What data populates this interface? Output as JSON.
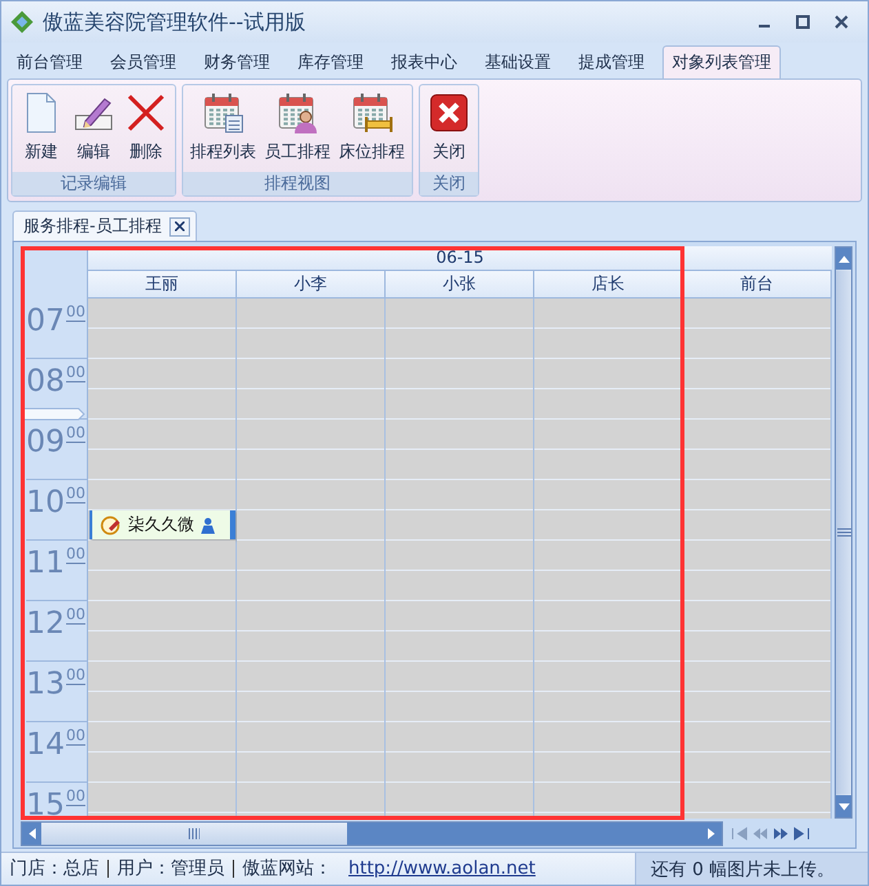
{
  "window": {
    "title": "傲蓝美容院管理软件--试用版"
  },
  "menu_tabs": [
    {
      "label": "前台管理",
      "selected": false
    },
    {
      "label": "会员管理",
      "selected": false
    },
    {
      "label": "财务管理",
      "selected": false
    },
    {
      "label": "库存管理",
      "selected": false
    },
    {
      "label": "报表中心",
      "selected": false
    },
    {
      "label": "基础设置",
      "selected": false
    },
    {
      "label": "提成管理",
      "selected": false
    },
    {
      "label": "对象列表管理",
      "selected": true
    }
  ],
  "ribbon_groups": [
    {
      "title": "记录编辑",
      "buttons": [
        {
          "label": "新建",
          "kind": "new"
        },
        {
          "label": "编辑",
          "kind": "edit"
        },
        {
          "label": "删除",
          "kind": "delete"
        }
      ]
    },
    {
      "title": "排程视图",
      "buttons": [
        {
          "label": "排程列表",
          "kind": "calendar-list"
        },
        {
          "label": "员工排程",
          "kind": "calendar-person"
        },
        {
          "label": "床位排程",
          "kind": "calendar-bed"
        }
      ]
    },
    {
      "title": "关闭",
      "buttons": [
        {
          "label": "关闭",
          "kind": "close"
        }
      ]
    }
  ],
  "document_tab": {
    "label": "服务排程-员工排程"
  },
  "schedule": {
    "date": "06-15",
    "resources": [
      {
        "name": "王丽"
      },
      {
        "name": "小李"
      },
      {
        "name": "小张"
      },
      {
        "name": "店长"
      },
      {
        "name": "前台"
      }
    ],
    "hours": [
      {
        "hour": "07",
        "minutes": "00"
      },
      {
        "hour": "08",
        "minutes": "00"
      },
      {
        "hour": "09",
        "minutes": "00"
      },
      {
        "hour": "10",
        "minutes": "00",
        "second_half": [
          "柒久久微"
        ]
      },
      {
        "hour": "11",
        "minutes": "00"
      },
      {
        "hour": "12",
        "minutes": "00"
      },
      {
        "hour": "13",
        "minutes": "00"
      },
      {
        "hour": "14",
        "minutes": "00"
      },
      {
        "hour": "15",
        "minutes": "00"
      }
    ]
  },
  "status_bar": {
    "items": [
      "门店：总店",
      "用户：管理员",
      "傲蓝网站："
    ],
    "link": "http://www.aolan.net",
    "upload_notice": "还有 0 幅图片未上传。"
  }
}
